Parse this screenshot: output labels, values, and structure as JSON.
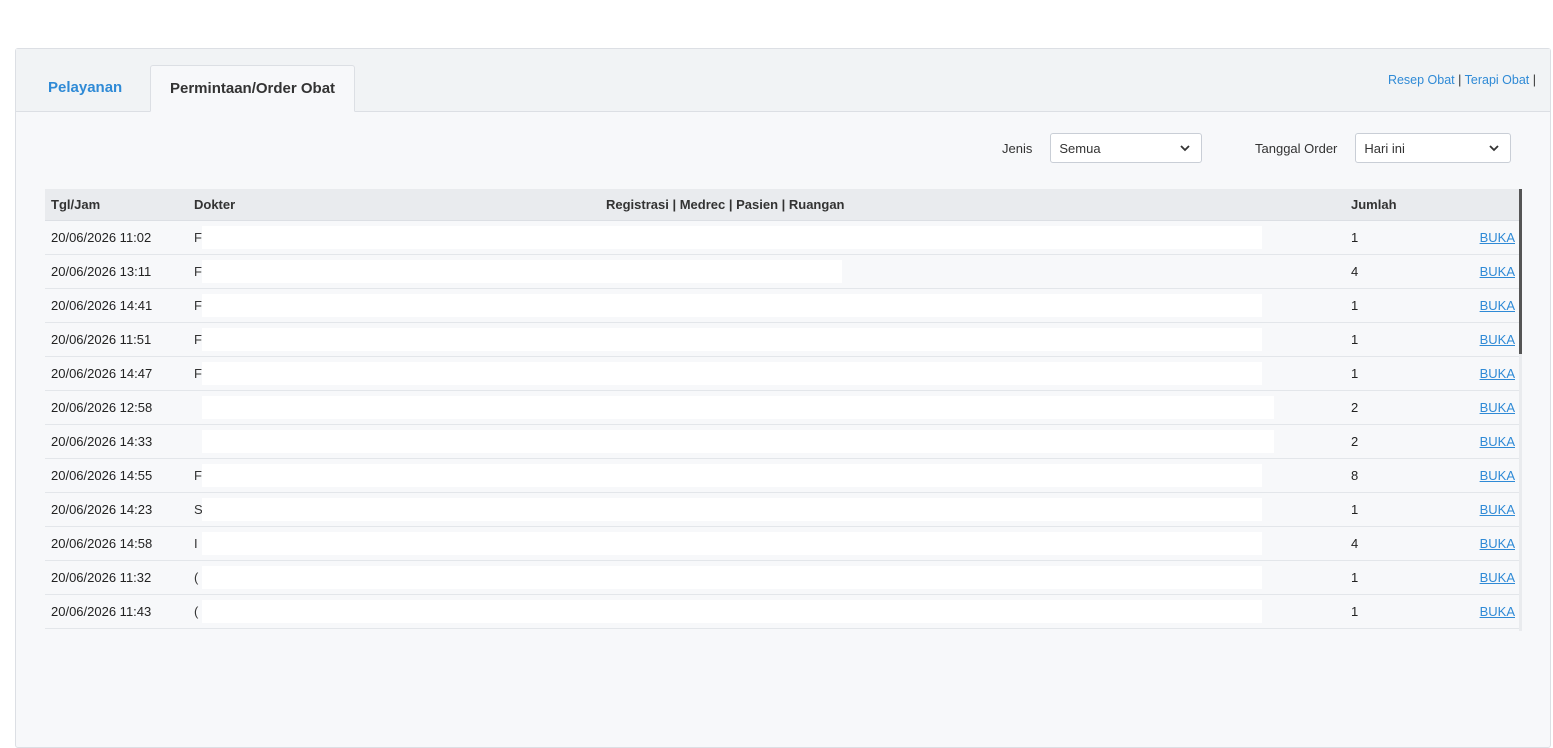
{
  "tabs": [
    {
      "label": "Pelayanan",
      "active": false
    },
    {
      "label": "Permintaan/Order Obat",
      "active": true
    }
  ],
  "top_links": {
    "resep": "Resep Obat",
    "terapi": "Terapi Obat",
    "sep": "|"
  },
  "filters": {
    "jenis_label": "Jenis",
    "jenis_value": "Semua",
    "tanggal_label": "Tanggal Order",
    "tanggal_value": "Hari ini"
  },
  "table": {
    "headers": [
      "Tgl/Jam",
      "Dokter",
      "Registrasi | Medrec | Pasien | Ruangan",
      "Jumlah",
      ""
    ],
    "rows": [
      {
        "tgl": "20/06/2026 11:02",
        "dokter": "F",
        "jumlah": "1",
        "action": "BUKA"
      },
      {
        "tgl": "20/06/2026 13:11",
        "dokter": "F",
        "jumlah": "4",
        "action": "BUKA"
      },
      {
        "tgl": "20/06/2026 14:41",
        "dokter": "F",
        "jumlah": "1",
        "action": "BUKA"
      },
      {
        "tgl": "20/06/2026 11:51",
        "dokter": "F",
        "jumlah": "1",
        "action": "BUKA"
      },
      {
        "tgl": "20/06/2026 14:47",
        "dokter": "F",
        "jumlah": "1",
        "action": "BUKA"
      },
      {
        "tgl": "20/06/2026 12:58",
        "dokter": "",
        "jumlah": "2",
        "action": "BUKA"
      },
      {
        "tgl": "20/06/2026 14:33",
        "dokter": "",
        "jumlah": "2",
        "action": "BUKA"
      },
      {
        "tgl": "20/06/2026 14:55",
        "dokter": "F",
        "jumlah": "8",
        "action": "BUKA"
      },
      {
        "tgl": "20/06/2026 14:23",
        "dokter": "S",
        "jumlah": "1",
        "action": "BUKA"
      },
      {
        "tgl": "20/06/2026 14:58",
        "dokter": "I",
        "jumlah": "4",
        "action": "BUKA"
      },
      {
        "tgl": "20/06/2026 11:32",
        "dokter": "(",
        "jumlah": "1",
        "action": "BUKA"
      },
      {
        "tgl": "20/06/2026 11:43",
        "dokter": "(",
        "jumlah": "1",
        "action": "BUKA"
      }
    ]
  },
  "colors": {
    "accent": "#2f8ad6",
    "header_bg": "#e9ebee",
    "panel_bg": "#f7f8fa"
  },
  "icons": {
    "select_caret": "chevron-down-icon"
  }
}
